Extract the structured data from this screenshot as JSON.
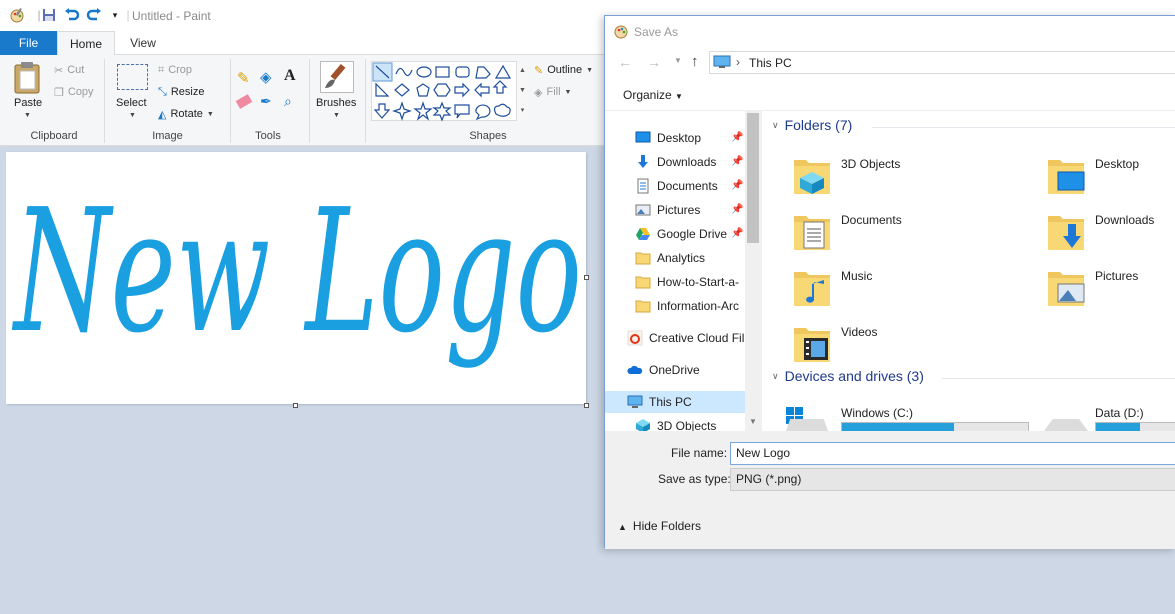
{
  "paint": {
    "title": "Untitled - Paint",
    "tabs": {
      "file": "File",
      "home": "Home",
      "view": "View"
    },
    "clipboard": {
      "paste": "Paste",
      "cut": "Cut",
      "copy": "Copy",
      "group": "Clipboard"
    },
    "image": {
      "select": "Select",
      "crop": "Crop",
      "resize": "Resize",
      "rotate": "Rotate",
      "group": "Image"
    },
    "tools": {
      "group": "Tools"
    },
    "brushes": {
      "label": "Brushes"
    },
    "shapes": {
      "group": "Shapes",
      "outline": "Outline",
      "fill": "Fill"
    },
    "canvas_text": "New Logo",
    "accent_color": "#1a9fe0"
  },
  "dialog": {
    "title": "Save As",
    "address": "This PC",
    "organize": "Organize",
    "nav_items": [
      {
        "label": "Desktop",
        "icon": "desktop-icon",
        "pinned": true
      },
      {
        "label": "Downloads",
        "icon": "downloads-icon",
        "pinned": true
      },
      {
        "label": "Documents",
        "icon": "documents-icon",
        "pinned": true
      },
      {
        "label": "Pictures",
        "icon": "pictures-icon",
        "pinned": true
      },
      {
        "label": "Google Drive",
        "icon": "google-drive-icon",
        "pinned": true
      },
      {
        "label": "Analytics",
        "icon": "folder-icon",
        "pinned": false
      },
      {
        "label": "How-to-Start-a-",
        "icon": "folder-icon",
        "pinned": false
      },
      {
        "label": "Information-Arc",
        "icon": "folder-icon",
        "pinned": false
      },
      {
        "label": "Creative Cloud Fil",
        "icon": "creative-cloud-icon",
        "pinned": false
      },
      {
        "label": "OneDrive",
        "icon": "onedrive-icon",
        "pinned": false
      },
      {
        "label": "This PC",
        "icon": "this-pc-icon",
        "pinned": false
      },
      {
        "label": "3D Objects",
        "icon": "3d-objects-icon",
        "pinned": false
      }
    ],
    "folders_header": "Folders (7)",
    "folders": [
      "3D Objects",
      "Desktop",
      "Documents",
      "Downloads",
      "Music",
      "Pictures",
      "Videos"
    ],
    "devices_header": "Devices and drives (3)",
    "drives": [
      {
        "label": "Windows (C:)",
        "used_fraction": 0.6
      },
      {
        "label": "Data (D:)",
        "used_fraction": 0.5
      }
    ],
    "file_name_label": "File name:",
    "file_name": "New Logo",
    "save_type_label": "Save as type:",
    "save_type": "PNG (*.png)",
    "hide_folders": "Hide Folders"
  }
}
